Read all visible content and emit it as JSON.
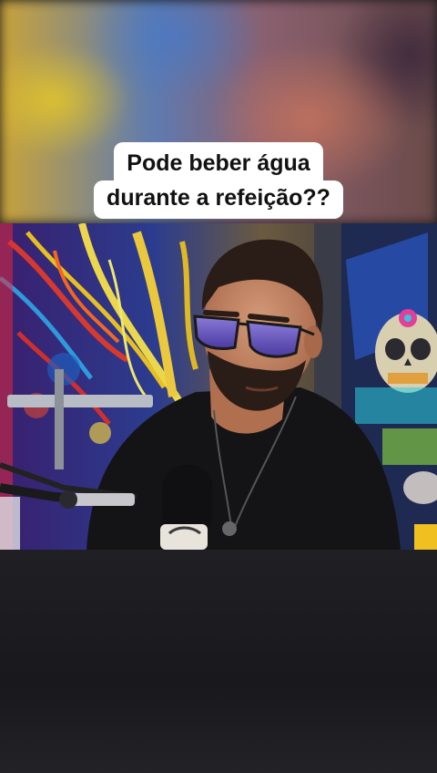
{
  "caption": {
    "line1": "Pode beber água",
    "line2": "durante a refeição??"
  },
  "colors": {
    "caption_bg": "#ffffff",
    "caption_text": "#111111",
    "backdrop": "#1b1a1e"
  },
  "scene": {
    "subject": "man-with-purple-sunglasses",
    "props": [
      "podcast-microphone",
      "skull-painting",
      "paint-splatter-art"
    ]
  }
}
